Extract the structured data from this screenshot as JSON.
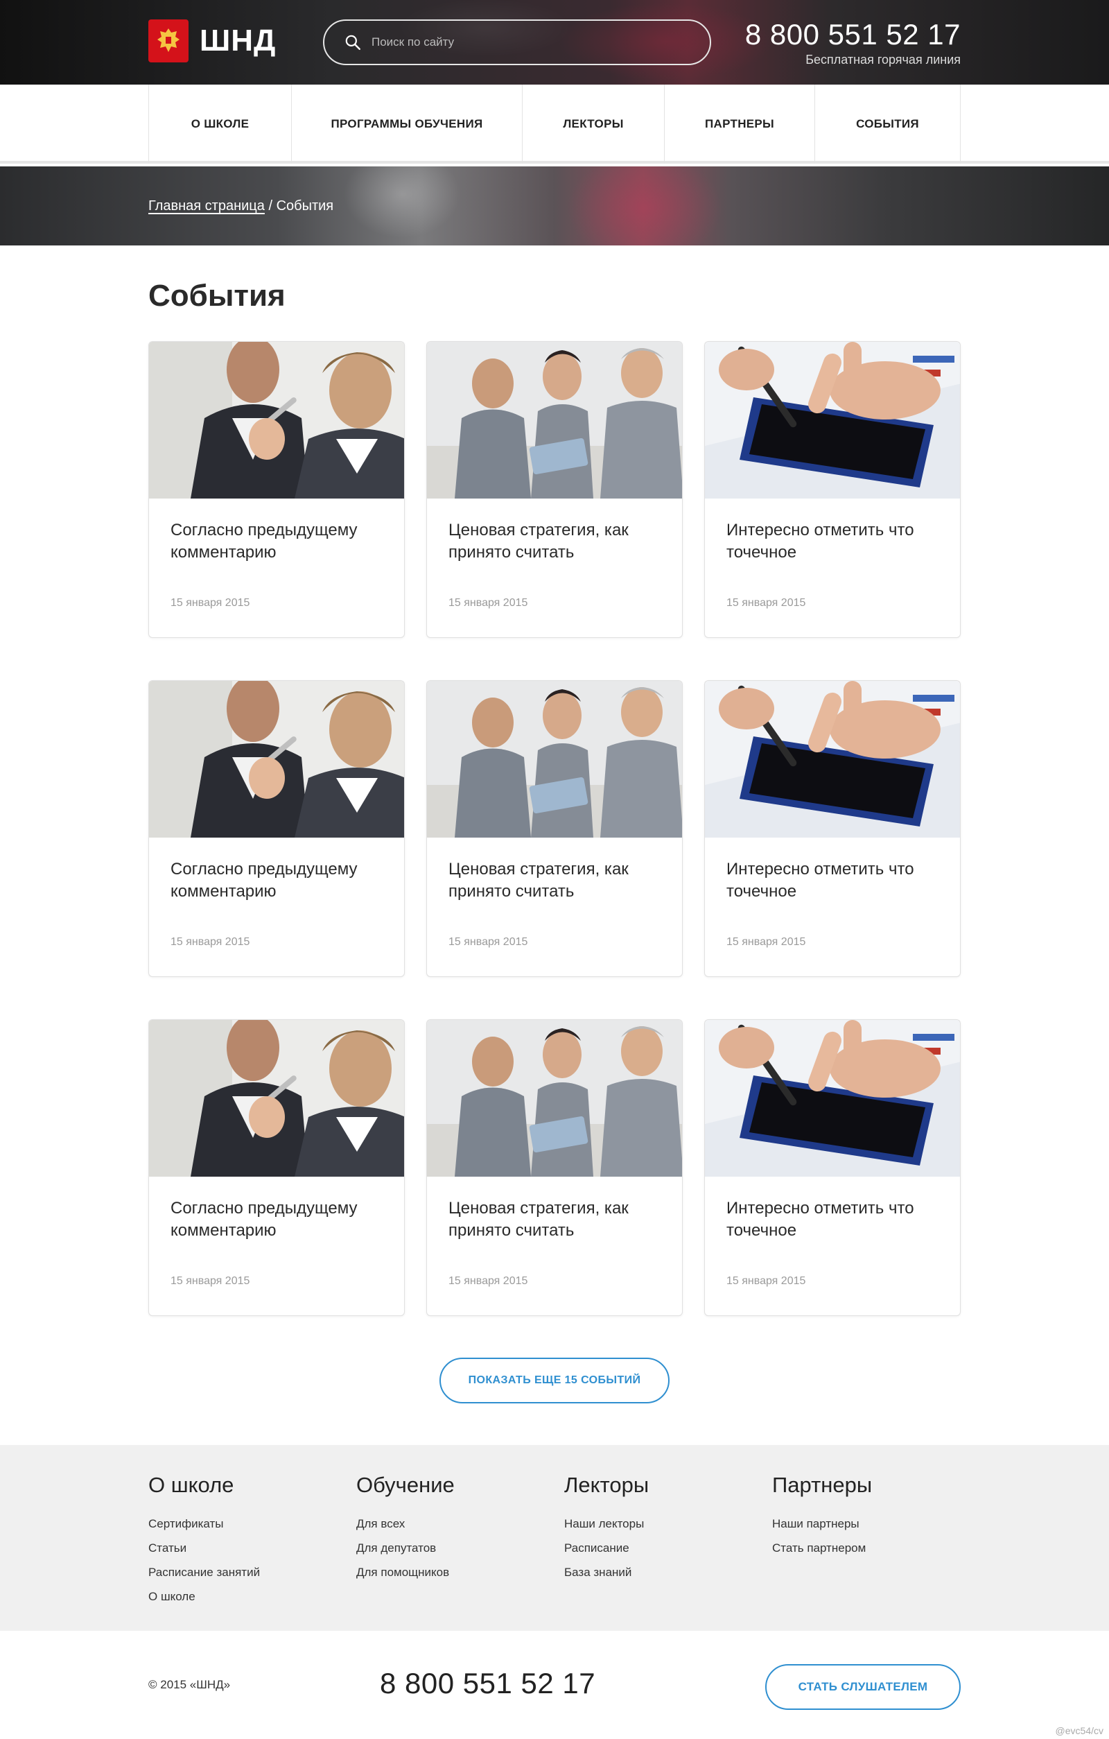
{
  "header": {
    "logo_text": "ШНД",
    "search_placeholder": "Поиск по сайту",
    "phone": "8 800 551 52 17",
    "phone_caption": "Бесплатная горячая линия"
  },
  "nav": {
    "items": [
      {
        "label": "О ШКОЛЕ"
      },
      {
        "label": "ПРОГРАММЫ ОБУЧЕНИЯ"
      },
      {
        "label": "ЛЕКТОРЫ"
      },
      {
        "label": "ПАРТНЕРЫ"
      },
      {
        "label": "СОБЫТИЯ"
      }
    ]
  },
  "breadcrumb": {
    "home": "Главная страница",
    "separator": " / ",
    "current": "События"
  },
  "main": {
    "title": "События",
    "cards": [
      {
        "title": "Согласно предыдущему комментарию",
        "date": "15 января 2015",
        "image": "meeting-photo"
      },
      {
        "title": "Ценовая стратегия, как принято считать",
        "date": "15 января 2015",
        "image": "team-tablet-photo"
      },
      {
        "title": "Интересно отметить что точечное",
        "date": "15 января 2015",
        "image": "tablet-hand-photo"
      },
      {
        "title": "Согласно предыдущему комментарию",
        "date": "15 января 2015",
        "image": "meeting-photo"
      },
      {
        "title": "Ценовая стратегия, как принято считать",
        "date": "15 января 2015",
        "image": "team-tablet-photo"
      },
      {
        "title": "Интересно отметить что точечное",
        "date": "15 января 2015",
        "image": "tablet-hand-photo"
      },
      {
        "title": "Согласно предыдущему комментарию",
        "date": "15 января 2015",
        "image": "meeting-photo"
      },
      {
        "title": "Ценовая стратегия, как принято считать",
        "date": "15 января 2015",
        "image": "team-tablet-photo"
      },
      {
        "title": "Интересно отметить что точечное",
        "date": "15 января 2015",
        "image": "tablet-hand-photo"
      }
    ],
    "more_button": "ПОКАЗАТЬ ЕЩЕ 15 СОБЫТИЙ"
  },
  "footer": {
    "columns": [
      {
        "title": "О школе",
        "links": [
          "Сертификаты",
          "Статьи",
          "Расписание занятий",
          "О школе"
        ]
      },
      {
        "title": "Обучение",
        "links": [
          "Для всех",
          "Для депутатов",
          "Для помощников"
        ]
      },
      {
        "title": "Лекторы",
        "links": [
          "Наши лекторы",
          "Расписание",
          "База знаний"
        ]
      },
      {
        "title": "Партнеры",
        "links": [
          "Наши партнеры",
          "Стать партнером"
        ]
      }
    ],
    "copyright": "© 2015 «ШНД»",
    "phone": "8 800 551 52 17",
    "cta": "СТАТЬ СЛУШАТЕЛЕМ",
    "watermark": "@evc54/cv"
  },
  "colors": {
    "accent": "#2f8fd0",
    "logo_red": "#d4121a"
  }
}
